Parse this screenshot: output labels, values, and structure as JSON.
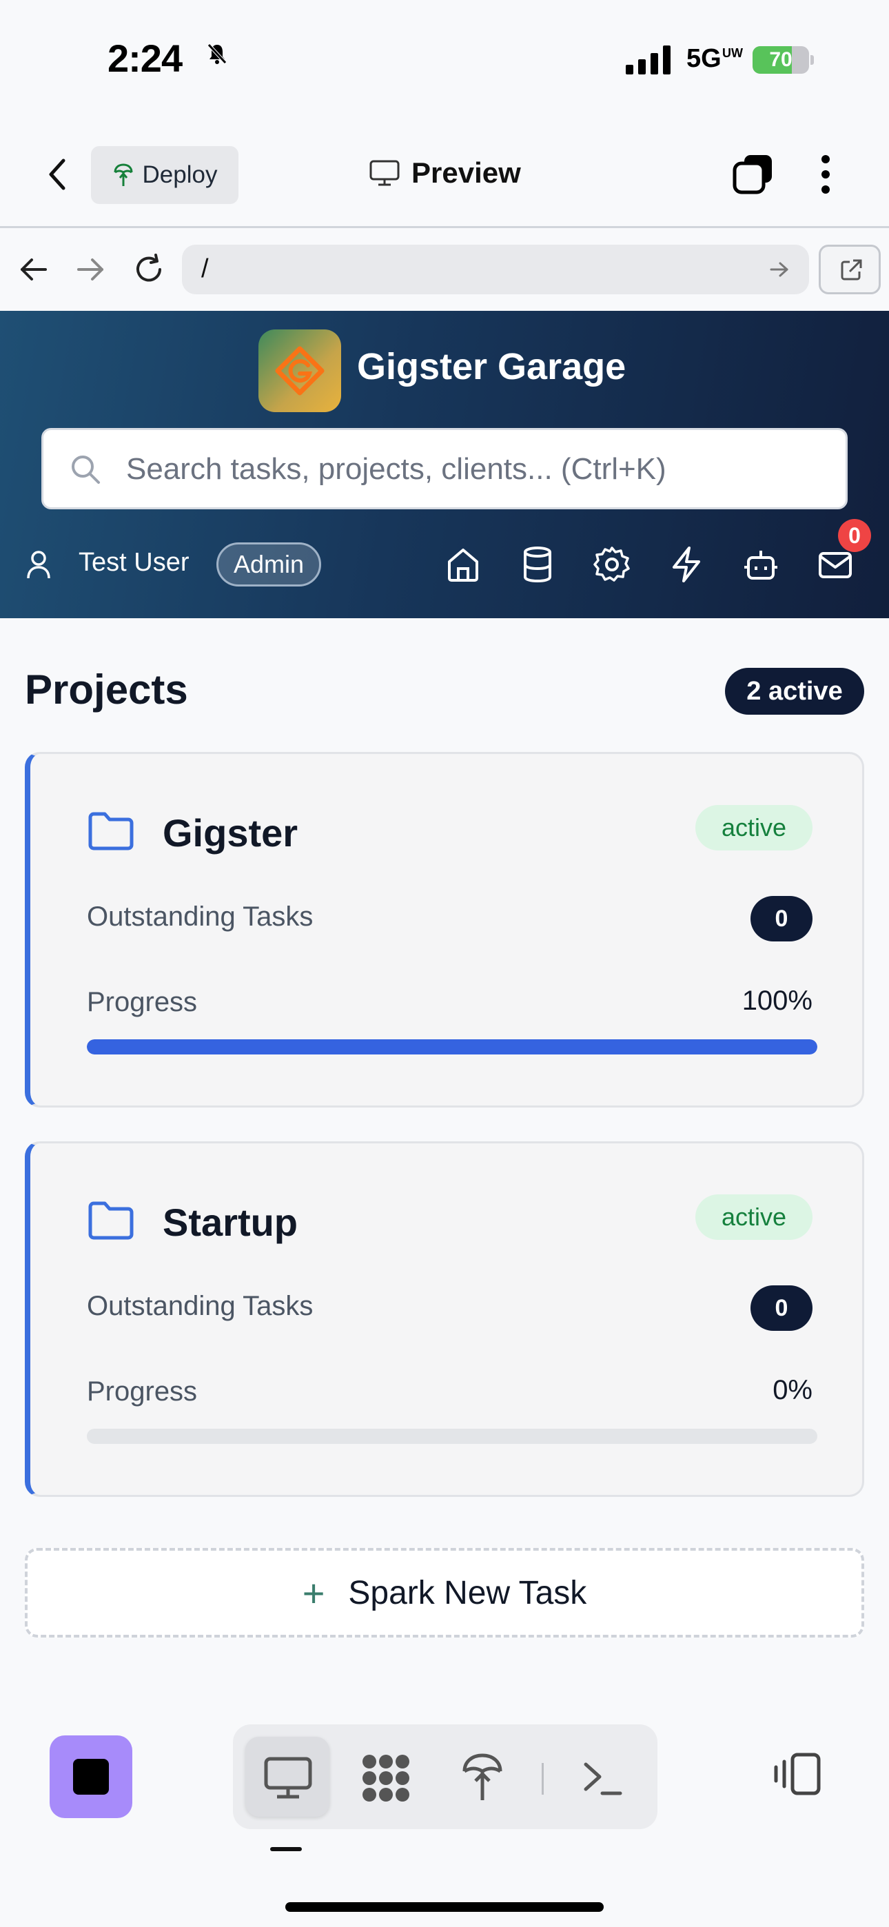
{
  "status_bar": {
    "time": "2:24",
    "network": "5G",
    "network_suffix": "UW",
    "battery_percent": "70",
    "battery_level": 0.7
  },
  "app_bar": {
    "deploy_label": "Deploy",
    "preview_label": "Preview"
  },
  "url_bar": {
    "url": "/"
  },
  "site_header": {
    "brand": "Gigster Garage",
    "search_placeholder": "Search tasks, projects, clients... (Ctrl+K)",
    "user_name": "Test User",
    "role_badge": "Admin",
    "nav_icons": [
      "home-icon",
      "database-icon",
      "gear-icon",
      "lightning-icon",
      "bot-icon",
      "mail-icon"
    ],
    "mail_count": "0"
  },
  "projects": {
    "title": "Projects",
    "active_count": "2 active",
    "items": [
      {
        "name": "Gigster",
        "status": "active",
        "outstanding_label": "Outstanding Tasks",
        "outstanding": "0",
        "progress_label": "Progress",
        "progress_text": "100%",
        "progress": 1.0
      },
      {
        "name": "Startup",
        "status": "active",
        "outstanding_label": "Outstanding Tasks",
        "outstanding": "0",
        "progress_label": "Progress",
        "progress_text": "0%",
        "progress": 0.0
      }
    ]
  },
  "actions": {
    "spark_plus": "+",
    "spark_label": "Spark New Task"
  },
  "toolbar": {
    "tabs": [
      "preview-icon",
      "workflow-icon",
      "deploy-icon",
      "terminal-icon"
    ],
    "active_tab": "preview-icon"
  },
  "colors": {
    "accent": "#3563e0",
    "header_dark": "#111f3c",
    "active_green": "#15803d",
    "badge_red": "#ef4444"
  }
}
